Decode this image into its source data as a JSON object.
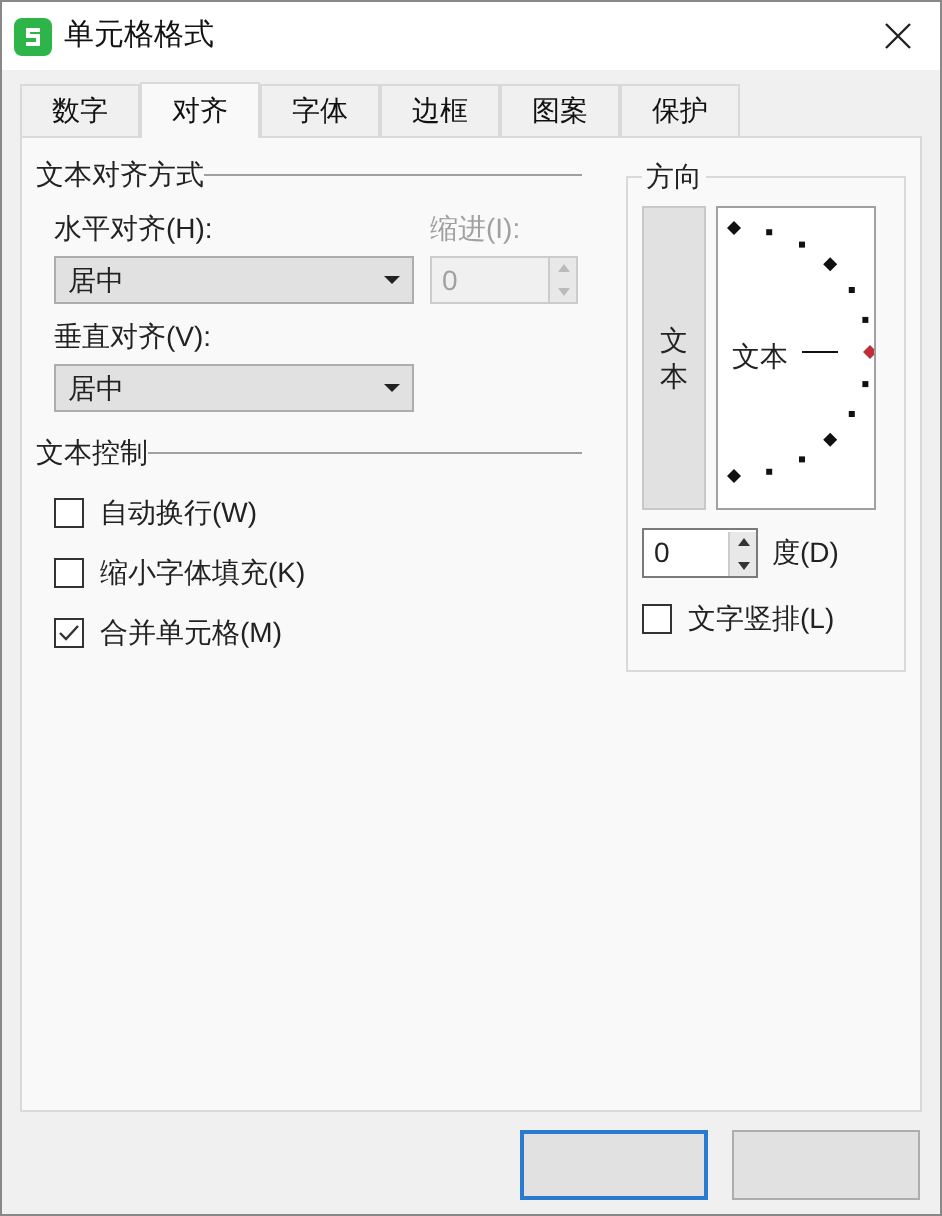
{
  "window": {
    "title": "单元格格式"
  },
  "tabs": [
    {
      "label": "数字",
      "selected": false
    },
    {
      "label": "对齐",
      "selected": true
    },
    {
      "label": "字体",
      "selected": false
    },
    {
      "label": "边框",
      "selected": false
    },
    {
      "label": "图案",
      "selected": false
    },
    {
      "label": "保护",
      "selected": false
    }
  ],
  "alignment": {
    "title": "文本对齐方式",
    "horizontal": {
      "label": "水平对齐(H):",
      "value": "居中"
    },
    "indent": {
      "label": "缩进(I):",
      "value": "0",
      "disabled": true
    },
    "vertical": {
      "label": "垂直对齐(V):",
      "value": "居中"
    }
  },
  "text_control": {
    "title": "文本控制",
    "options": [
      {
        "label": "自动换行(W)",
        "checked": false
      },
      {
        "label": "缩小字体填充(K)",
        "checked": false
      },
      {
        "label": "合并单元格(M)",
        "checked": true
      }
    ]
  },
  "orientation": {
    "title": "方向",
    "vertical_text": "文本",
    "dial_text": "文本",
    "degrees": {
      "value": "0",
      "label": "度(D)"
    },
    "stacked": {
      "label": "文字竖排(L)",
      "checked": false
    }
  },
  "buttons": [
    {
      "default": true
    },
    {
      "default": false
    }
  ]
}
